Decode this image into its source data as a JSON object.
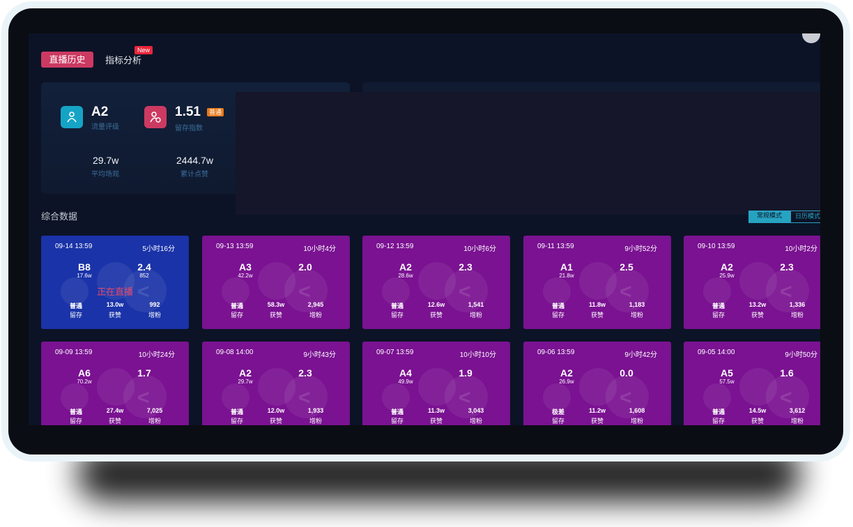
{
  "tabs": {
    "history": "直播历史",
    "analysis": "指标分析",
    "new_badge": "New"
  },
  "stats": {
    "traffic_grade": "A2",
    "traffic_grade_label": "流量评级",
    "retention_index": "1.51",
    "retention_index_label": "留存指数",
    "retention_badge": "普通",
    "avg_views": "29.7w",
    "avg_views_label": "平均场观",
    "total_likes": "2444.7w",
    "total_likes_label": "累计点赞"
  },
  "section_title": "综合数据",
  "mode_toggle": {
    "option_a": "常规模式",
    "option_b": "日历模式"
  },
  "card_labels": {
    "retention": "留存",
    "likes": "获赞",
    "followers": "增粉"
  },
  "cards": [
    {
      "date": "09-14 13:59",
      "duration": "5小时16分",
      "grade": "B8",
      "views": "17.6w",
      "index": "2.4",
      "index_sub": "852",
      "status": "正在直播",
      "retention": "普通",
      "likes": "13.0w",
      "followers": "992"
    },
    {
      "date": "09-13 13:59",
      "duration": "10小时4分",
      "grade": "A3",
      "views": "42.2w",
      "index": "2.0",
      "retention": "普通",
      "likes": "58.3w",
      "followers": "2,945"
    },
    {
      "date": "09-12 13:59",
      "duration": "10小时6分",
      "grade": "A2",
      "views": "28.6w",
      "index": "2.3",
      "retention": "普通",
      "likes": "12.6w",
      "followers": "1,541"
    },
    {
      "date": "09-11 13:59",
      "duration": "9小时52分",
      "grade": "A1",
      "views": "21.8w",
      "index": "2.5",
      "retention": "普通",
      "likes": "11.8w",
      "followers": "1,183"
    },
    {
      "date": "09-10 13:59",
      "duration": "10小时2分",
      "grade": "A2",
      "views": "25.9w",
      "index": "2.3",
      "retention": "普通",
      "likes": "13.2w",
      "followers": "1,336"
    },
    {
      "date": "09-09 13:59",
      "duration": "10小时24分",
      "grade": "A6",
      "views": "70.2w",
      "index": "1.7",
      "retention": "普通",
      "likes": "27.4w",
      "followers": "7,025"
    },
    {
      "date": "09-08 14:00",
      "duration": "9小时43分",
      "grade": "A2",
      "views": "29.7w",
      "index": "2.3",
      "retention": "普通",
      "likes": "12.0w",
      "followers": "1,933"
    },
    {
      "date": "09-07 13:59",
      "duration": "10小时10分",
      "grade": "A4",
      "views": "49.9w",
      "index": "1.9",
      "retention": "普通",
      "likes": "11.3w",
      "followers": "3,043"
    },
    {
      "date": "09-06 13:59",
      "duration": "9小时42分",
      "grade": "A2",
      "views": "26.9w",
      "index": "0.0",
      "retention": "极差",
      "likes": "11.2w",
      "followers": "1,608"
    },
    {
      "date": "09-05 14:00",
      "duration": "9小时50分",
      "grade": "A5",
      "views": "57.5w",
      "index": "1.6",
      "retention": "普通",
      "likes": "14.5w",
      "followers": "3,612"
    }
  ]
}
